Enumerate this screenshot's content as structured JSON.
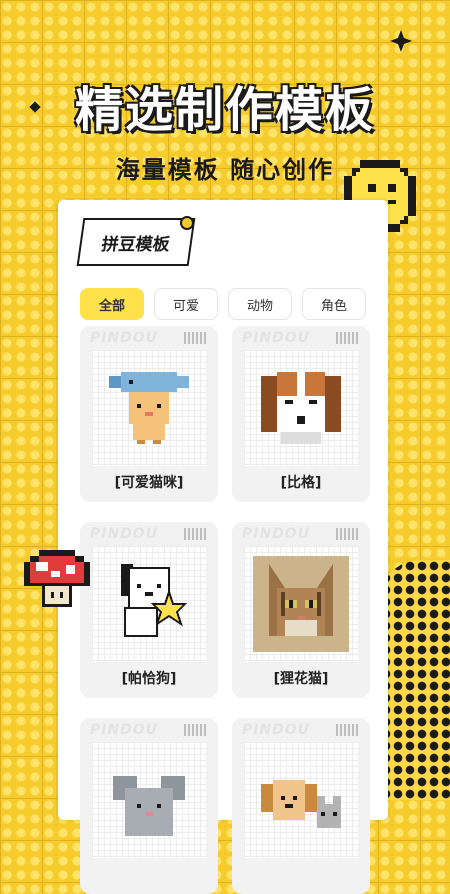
{
  "header": {
    "headline": "精选制作模板",
    "subline": "海量模板  随心创作"
  },
  "panel": {
    "title": "拼豆模板",
    "tabs": [
      {
        "label": "全部",
        "active": true
      },
      {
        "label": "可爱",
        "active": false
      },
      {
        "label": "动物",
        "active": false
      },
      {
        "label": "角色",
        "active": false
      }
    ],
    "cards": [
      {
        "brand": "PINDOU",
        "label": "可爱猫咪",
        "icon": "fish-hat-cat-icon"
      },
      {
        "brand": "PINDOU",
        "label": "比格",
        "icon": "beagle-dog-icon"
      },
      {
        "brand": "PINDOU",
        "label": "帕恰狗",
        "icon": "pochacco-icon"
      },
      {
        "brand": "PINDOU",
        "label": "狸花猫",
        "icon": "tabby-cat-icon"
      },
      {
        "brand": "PINDOU",
        "label": "",
        "icon": "gray-mouse-icon"
      },
      {
        "brand": "PINDOU",
        "label": "",
        "icon": "puppy-kitten-icon"
      }
    ]
  },
  "colors": {
    "background": "#f6cc2c",
    "accent_tab": "#ffe24a",
    "panel": "#ffffff"
  }
}
